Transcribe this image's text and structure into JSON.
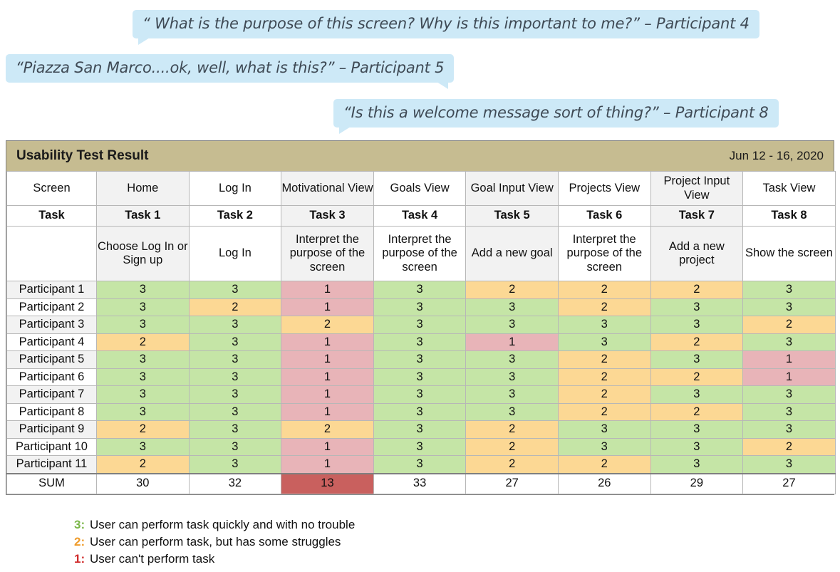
{
  "quotes": [
    {
      "text": "“ What is the purpose of this screen? Why is this important to me?” – Participant 4"
    },
    {
      "text": "“Piazza San Marco....ok, well, what is this?” – Participant 5"
    },
    {
      "text": "“Is this a welcome message sort of thing?” – Participant 8"
    }
  ],
  "card": {
    "title": "Usability Test Result",
    "date_range": "Jun 12 - 16, 2020",
    "row_labels": {
      "screen": "Screen",
      "task": "Task",
      "sum": "SUM"
    }
  },
  "chart_data": {
    "type": "table",
    "title": "Usability Test Result",
    "screens": [
      "Home",
      "Log In",
      "Motivational View",
      "Goals View",
      "Goal Input View",
      "Projects View",
      "Project Input View",
      "Task View"
    ],
    "task_numbers": [
      "Task 1",
      "Task 2",
      "Task 3",
      "Task 4",
      "Task 5",
      "Task 6",
      "Task 7",
      "Task 8"
    ],
    "task_descriptions": [
      "Choose Log In or Sign up",
      "Log In",
      "Interpret the purpose of the screen",
      "Interpret the purpose of the screen",
      "Add a new goal",
      "Interpret the purpose of the screen",
      "Add a new project",
      "Show the screen"
    ],
    "participants": [
      "Participant 1",
      "Participant 2",
      "Participant 3",
      "Participant 4",
      "Participant 5",
      "Participant 6",
      "Participant 7",
      "Participant 8",
      "Participant 9",
      "Participant 10",
      "Participant 11"
    ],
    "scores": [
      [
        3,
        3,
        1,
        3,
        2,
        2,
        2,
        3
      ],
      [
        3,
        2,
        1,
        3,
        3,
        2,
        3,
        3
      ],
      [
        3,
        3,
        2,
        3,
        3,
        3,
        3,
        2
      ],
      [
        2,
        3,
        1,
        3,
        1,
        3,
        2,
        3
      ],
      [
        3,
        3,
        1,
        3,
        3,
        2,
        3,
        1
      ],
      [
        3,
        3,
        1,
        3,
        3,
        2,
        2,
        1
      ],
      [
        3,
        3,
        1,
        3,
        3,
        2,
        3,
        3
      ],
      [
        3,
        3,
        1,
        3,
        3,
        2,
        2,
        3
      ],
      [
        2,
        3,
        2,
        3,
        2,
        3,
        3,
        3
      ],
      [
        3,
        3,
        1,
        3,
        2,
        3,
        3,
        2
      ],
      [
        2,
        3,
        1,
        3,
        2,
        2,
        3,
        3
      ]
    ],
    "sums": [
      30,
      32,
      13,
      33,
      27,
      26,
      29,
      27
    ],
    "sum_highlight_index": 2,
    "scale": {
      "3": "green",
      "2": "orange",
      "1": "red"
    },
    "colors": {
      "score_3": "#c5e5a6",
      "score_2": "#fcd894",
      "score_1": "#e8b4b8",
      "sum_highlight": "#c9605e",
      "title_bar": "#c6bc91",
      "bubble": "#cde9f7"
    }
  },
  "legend": [
    {
      "key": "3:",
      "text": "User can perform task quickly and with no trouble"
    },
    {
      "key": "2:",
      "text": "User can perform task, but has some struggles"
    },
    {
      "key": "1:",
      "text": "User can't perform task"
    }
  ]
}
